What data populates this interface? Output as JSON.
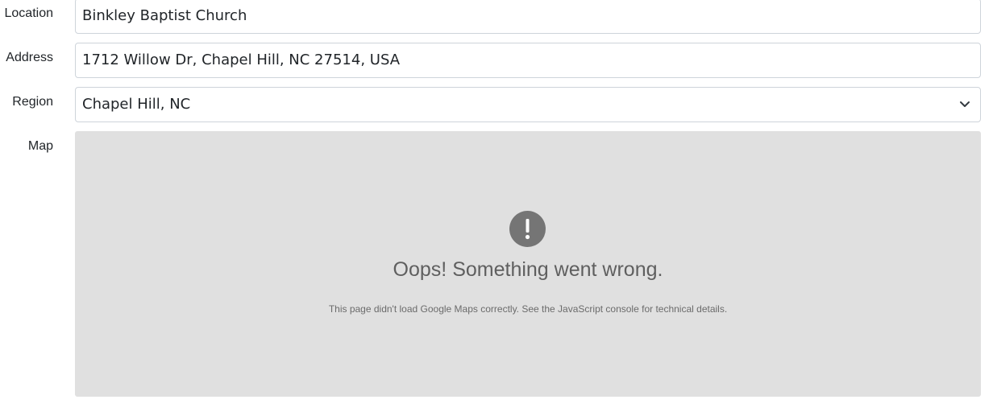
{
  "form": {
    "location": {
      "label": "Location",
      "value": "Binkley Baptist Church"
    },
    "address": {
      "label": "Address",
      "value": "1712 Willow Dr, Chapel Hill, NC 27514, USA"
    },
    "region": {
      "label": "Region",
      "selected": "Chapel Hill, NC",
      "icon": "chevron-down-icon"
    },
    "map": {
      "label": "Map",
      "error_icon": "exclamation-circle-icon",
      "error_title": "Oops! Something went wrong.",
      "error_detail": "This page didn't load Google Maps correctly. See the JavaScript console for technical details."
    }
  },
  "colors": {
    "field_border": "#ced4da",
    "map_background": "#e0e0e0",
    "error_icon": "#757575",
    "error_text": "#5f5f5f"
  }
}
